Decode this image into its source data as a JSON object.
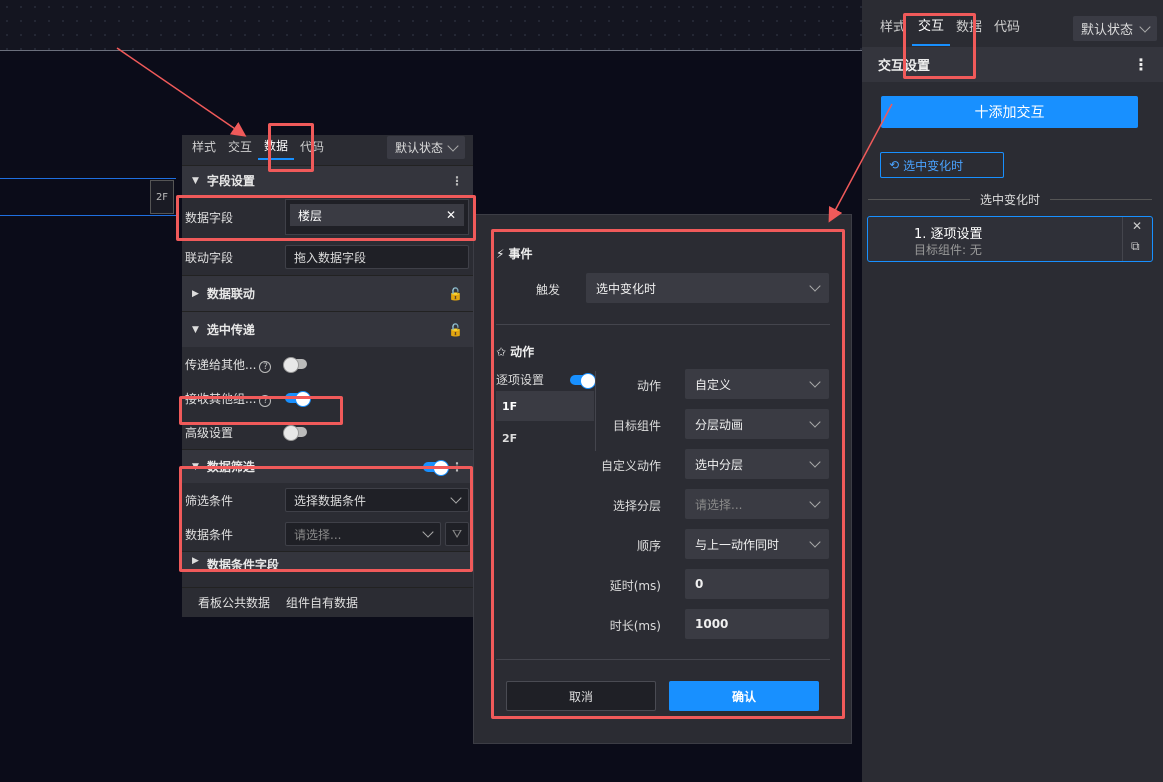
{
  "canvas": {
    "tag_label": "2F"
  },
  "mid": {
    "tabs": [
      "样式",
      "交互",
      "数据",
      "代码"
    ],
    "active_tab": "数据",
    "state_select": "默认状态",
    "section_field": "字段设置",
    "data_field_label": "数据字段",
    "data_field_value": "楼层",
    "link_field_label": "联动字段",
    "link_field_placeholder": "拖入数据字段",
    "section_data_link": "数据联动",
    "section_selected_pass": "选中传递",
    "pass_to_others_label": "传递给其他...",
    "receive_others_label": "接收其他组...",
    "advanced_label": "高级设置",
    "section_filter": "数据筛选",
    "filter_cond_label": "筛选条件",
    "filter_cond_value": "选择数据条件",
    "data_cond_label": "数据条件",
    "data_cond_placeholder": "请选择...",
    "section_partial": "数据条件字段",
    "footer_tabs": [
      "看板公共数据",
      "组件自有数据"
    ]
  },
  "dialog": {
    "event_title": "事件",
    "trigger_label": "触发",
    "trigger_value": "选中变化时",
    "action_title": "动作",
    "item_setting_label": "逐项设置",
    "floors": [
      "1F",
      "2F"
    ],
    "action_label": "动作",
    "action_value": "自定义",
    "target_label": "目标组件",
    "target_value": "分层动画",
    "custom_action_label": "自定义动作",
    "custom_action_value": "选中分层",
    "choose_layer_label": "选择分层",
    "choose_layer_placeholder": "请选择...",
    "order_label": "顺序",
    "order_value": "与上一动作同时",
    "delay_label": "延时(ms)",
    "delay_value": "0",
    "duration_label": "时长(ms)",
    "duration_value": "1000",
    "cancel_label": "取消",
    "confirm_label": "确认"
  },
  "right": {
    "tabs": [
      "样式",
      "交互",
      "数据",
      "代码"
    ],
    "active_tab": "交互",
    "state_select": "默认状态",
    "section_title": "交互设置",
    "add_button": "十添加交互",
    "event_tag": "选中变化时",
    "divider_title": "选中变化时",
    "card_title": "1. 逐项设置",
    "card_sub": "目标组件: 无"
  },
  "colors": {
    "accent": "#1890ff",
    "highlight": "#f05a5a",
    "panel": "#2b2c33"
  }
}
